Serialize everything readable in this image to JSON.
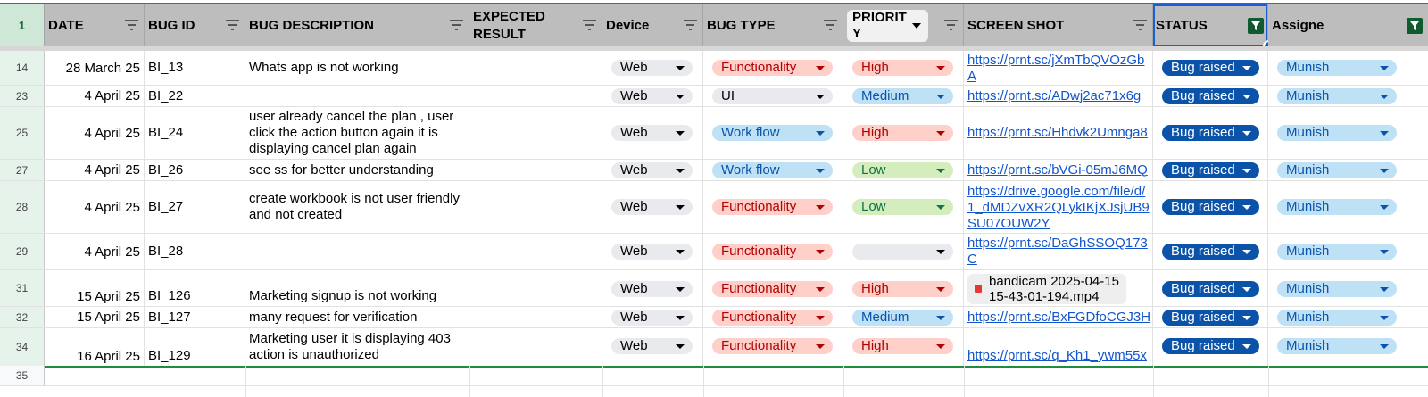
{
  "header": {
    "row_number": "1",
    "columns": [
      {
        "label": "DATE"
      },
      {
        "label": "BUG ID"
      },
      {
        "label": "BUG DESCRIPTION"
      },
      {
        "label": "EXPECTED RESULT"
      },
      {
        "label": "Device"
      },
      {
        "label": "BUG TYPE"
      },
      {
        "label": "PRIORITY"
      },
      {
        "label": "SCREEN SHOT"
      },
      {
        "label": "STATUS"
      },
      {
        "label": "Assigne"
      }
    ]
  },
  "rows": [
    {
      "num": "14",
      "date": "28 March 25",
      "id": "BI_13",
      "desc": "Whats app is not working",
      "expected": "",
      "device": "Web",
      "type": "Functionality",
      "priority": "High",
      "screenshot": "https://prnt.sc/jXmTbQVOzGbA",
      "status": "Bug raised",
      "assignee": "Munish"
    },
    {
      "num": "23",
      "date": "4 April 25",
      "id": "BI_22",
      "desc": "",
      "expected": "",
      "device": "Web",
      "type": "UI",
      "priority": "Medium",
      "screenshot": "https://prnt.sc/ADwj2ac71x6g",
      "status": "Bug raised",
      "assignee": "Munish"
    },
    {
      "num": "25",
      "date": "4 April 25",
      "id": "BI_24",
      "desc": "user already cancel the plan , user click the action button again it is displaying cancel plan again",
      "expected": "",
      "device": "Web",
      "type": "Work flow",
      "priority": "High",
      "screenshot": "https://prnt.sc/Hhdvk2Umnga8",
      "status": "Bug raised",
      "assignee": "Munish"
    },
    {
      "num": "27",
      "date": "4 April 25",
      "id": "BI_26",
      "desc": "see ss for better understanding",
      "expected": "",
      "device": "Web",
      "type": "Work flow",
      "priority": "Low",
      "screenshot": "https://prnt.sc/bVGi-05mJ6MQ",
      "status": "Bug raised",
      "assignee": "Munish"
    },
    {
      "num": "28",
      "date": "4 April 25",
      "id": "BI_27",
      "desc": "create workbook is not user friendly and not  created",
      "expected": "",
      "device": "Web",
      "type": "Functionality",
      "priority": "Low",
      "screenshot": "https://drive.google.com/file/d/1_dMDZvXR2QLykIKjXJsjUB9SU07OUW2Y",
      "status": "Bug raised",
      "assignee": "Munish"
    },
    {
      "num": "29",
      "date": "4 April 25",
      "id": "BI_28",
      "desc": "",
      "expected": "",
      "device": "Web",
      "type": "Functionality",
      "priority": "",
      "screenshot": "https://prnt.sc/DaGhSSOQ173C",
      "status": "Bug raised",
      "assignee": "Munish"
    },
    {
      "num": "31",
      "date": "15 April 25",
      "id": "BI_126",
      "desc": "Marketing signup  is not working",
      "expected": "",
      "device": "Web",
      "type": "Functionality",
      "priority": "High",
      "screenshot_file": "bandicam 2025-04-15 15-43-01-194.mp4",
      "status": "Bug raised",
      "assignee": "Munish"
    },
    {
      "num": "32",
      "date": "15 April 25",
      "id": "BI_127",
      "desc": "many request for verification",
      "expected": "",
      "device": "Web",
      "type": "Functionality",
      "priority": "Medium",
      "screenshot": "https://prnt.sc/BxFGDfoCGJ3H",
      "status": "Bug raised",
      "assignee": "Munish"
    },
    {
      "num": "34",
      "date": "16 April 25",
      "id": "BI_129",
      "desc": "Marketing user it is displaying 403 action is unauthorized",
      "expected": "",
      "device": "Web",
      "type": "Functionality",
      "priority": "High",
      "screenshot": "https://prnt.sc/q_Kh1_ywm55x",
      "status": "Bug raised",
      "assignee": "Munish"
    }
  ],
  "empty_row_number": "35",
  "colors": {
    "functionality_bg": "#ffcfc9",
    "ui_bg": "#e8eaed",
    "workflow_bg": "#bfe1f6",
    "high_bg": "#ffcfc9",
    "medium_bg": "#bfe1f6",
    "low_bg": "#d4edbc",
    "status_bg": "#0a53a8",
    "assignee_bg": "#bfe1f6",
    "device_bg": "#e8eaed",
    "link": "#1155cc",
    "header_bg": "#bdbdbd"
  }
}
